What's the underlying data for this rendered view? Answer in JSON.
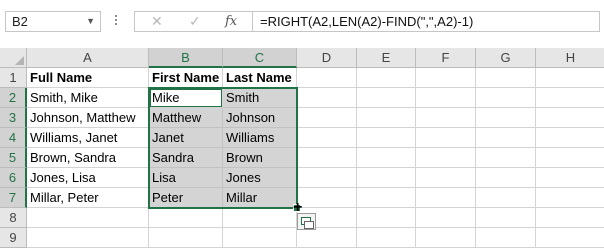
{
  "formula_bar": {
    "name_box": "B2",
    "cancel_icon": "✕",
    "enter_icon": "✓",
    "fx_label": "fx",
    "formula": "=RIGHT(A2,LEN(A2)-FIND(\",\",A2)-1)"
  },
  "columns": [
    "A",
    "B",
    "C",
    "D",
    "E",
    "F",
    "G",
    "H"
  ],
  "rows": [
    "1",
    "2",
    "3",
    "4",
    "5",
    "6",
    "7",
    "8",
    "9"
  ],
  "header_row": [
    "Full Name",
    "First Name",
    "Last Name"
  ],
  "data_rows": [
    [
      "Smith, Mike",
      "Mike",
      "Smith"
    ],
    [
      "Johnson, Matthew",
      "Matthew",
      "Johnson"
    ],
    [
      "Williams, Janet",
      "Janet",
      "Williams"
    ],
    [
      "Brown, Sandra",
      "Sandra",
      "Brown"
    ],
    [
      "Jones, Lisa",
      "Lisa",
      "Jones"
    ],
    [
      "Millar, Peter",
      "Peter",
      "Millar"
    ]
  ],
  "selection": {
    "range": "B2:C7",
    "active_cell": "B2"
  },
  "colors": {
    "accent": "#217346",
    "selected_fill": "#d4d4d4",
    "header_bg": "#e6e6e6"
  },
  "icons": [
    "chevron-down-icon",
    "cancel-icon",
    "enter-icon",
    "function-icon",
    "quick-analysis-icon",
    "crosshair-cursor-icon"
  ]
}
